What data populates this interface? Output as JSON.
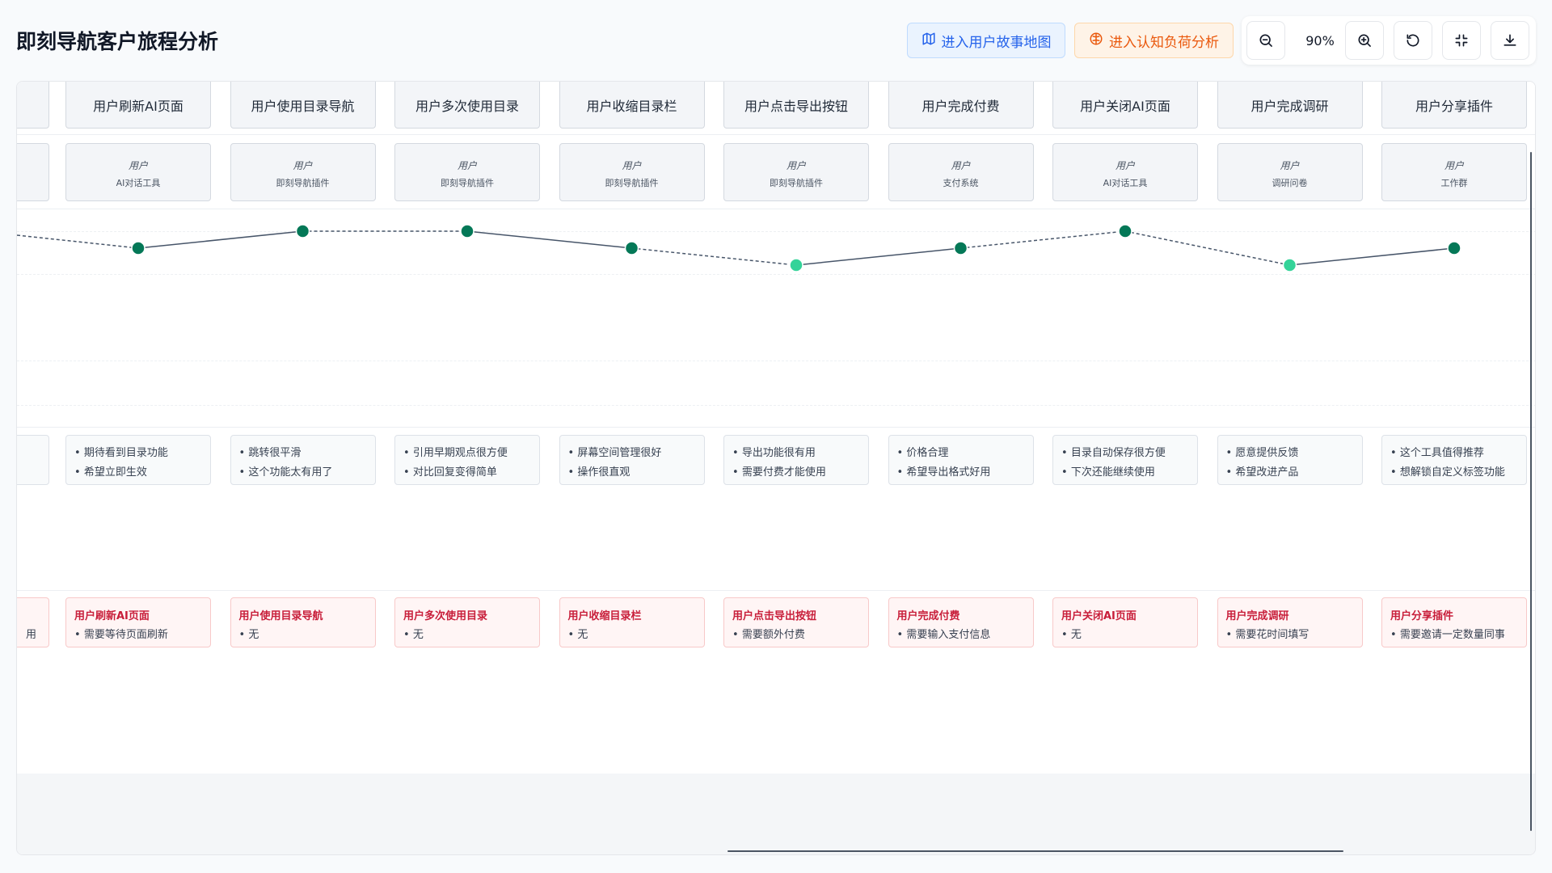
{
  "title": "即刻导航客户旅程分析",
  "nav": {
    "story_map_label": "进入用户故事地图",
    "cognitive_label": "进入认知负荷分析"
  },
  "toolbar": {
    "zoom_level": "90%",
    "icons": [
      "zoom-out-icon",
      "zoom-in-icon",
      "reset-icon",
      "collapse-icon",
      "download-icon"
    ]
  },
  "colors": {
    "accent_blue": "#2563eb",
    "accent_orange": "#ea580c",
    "curve_dark": "#047857",
    "curve_light": "#34d399",
    "pain_red": "#c81e3a"
  },
  "partial_pain_text": "用",
  "journey": {
    "emotion_scale": [
      "high",
      "medium",
      "low"
    ],
    "steps": [
      {
        "stage": "用户刷新AI页面",
        "role": "用户",
        "tool": "AI对话工具",
        "emotion": "medium",
        "link_in": "dashed",
        "thoughts": [
          "期待看到目录功能",
          "希望立即生效"
        ],
        "pain_title": "用户刷新AI页面",
        "pain": "需要等待页面刷新"
      },
      {
        "stage": "用户使用目录导航",
        "role": "用户",
        "tool": "即刻导航插件",
        "emotion": "high",
        "link_in": "solid",
        "thoughts": [
          "跳转很平滑",
          "这个功能太有用了"
        ],
        "pain_title": "用户使用目录导航",
        "pain": "无"
      },
      {
        "stage": "用户多次使用目录",
        "role": "用户",
        "tool": "即刻导航插件",
        "emotion": "high",
        "link_in": "dashed",
        "thoughts": [
          "引用早期观点很方便",
          "对比回复变得简单"
        ],
        "pain_title": "用户多次使用目录",
        "pain": "无"
      },
      {
        "stage": "用户收缩目录栏",
        "role": "用户",
        "tool": "即刻导航插件",
        "emotion": "medium",
        "link_in": "solid",
        "thoughts": [
          "屏幕空间管理很好",
          "操作很直观"
        ],
        "pain_title": "用户收缩目录栏",
        "pain": "无"
      },
      {
        "stage": "用户点击导出按钮",
        "role": "用户",
        "tool": "即刻导航插件",
        "emotion": "low",
        "link_in": "dashed",
        "thoughts": [
          "导出功能很有用",
          "需要付费才能使用"
        ],
        "pain_title": "用户点击导出按钮",
        "pain": "需要额外付费"
      },
      {
        "stage": "用户完成付费",
        "role": "用户",
        "tool": "支付系统",
        "emotion": "medium",
        "link_in": "solid",
        "thoughts": [
          "价格合理",
          "希望导出格式好用"
        ],
        "pain_title": "用户完成付费",
        "pain": "需要输入支付信息"
      },
      {
        "stage": "用户关闭AI页面",
        "role": "用户",
        "tool": "AI对话工具",
        "emotion": "high",
        "link_in": "dashed",
        "thoughts": [
          "目录自动保存很方便",
          "下次还能继续使用"
        ],
        "pain_title": "用户关闭AI页面",
        "pain": "无"
      },
      {
        "stage": "用户完成调研",
        "role": "用户",
        "tool": "调研问卷",
        "emotion": "low",
        "link_in": "dashed",
        "thoughts": [
          "愿意提供反馈",
          "希望改进产品"
        ],
        "pain_title": "用户完成调研",
        "pain": "需要花时间填写"
      },
      {
        "stage": "用户分享插件",
        "role": "用户",
        "tool": "工作群",
        "emotion": "medium",
        "link_in": "solid",
        "thoughts": [
          "这个工具值得推荐",
          "想解锁自定义标签功能"
        ],
        "pain_title": "用户分享插件",
        "pain": "需要邀请一定数量同事"
      }
    ]
  }
}
